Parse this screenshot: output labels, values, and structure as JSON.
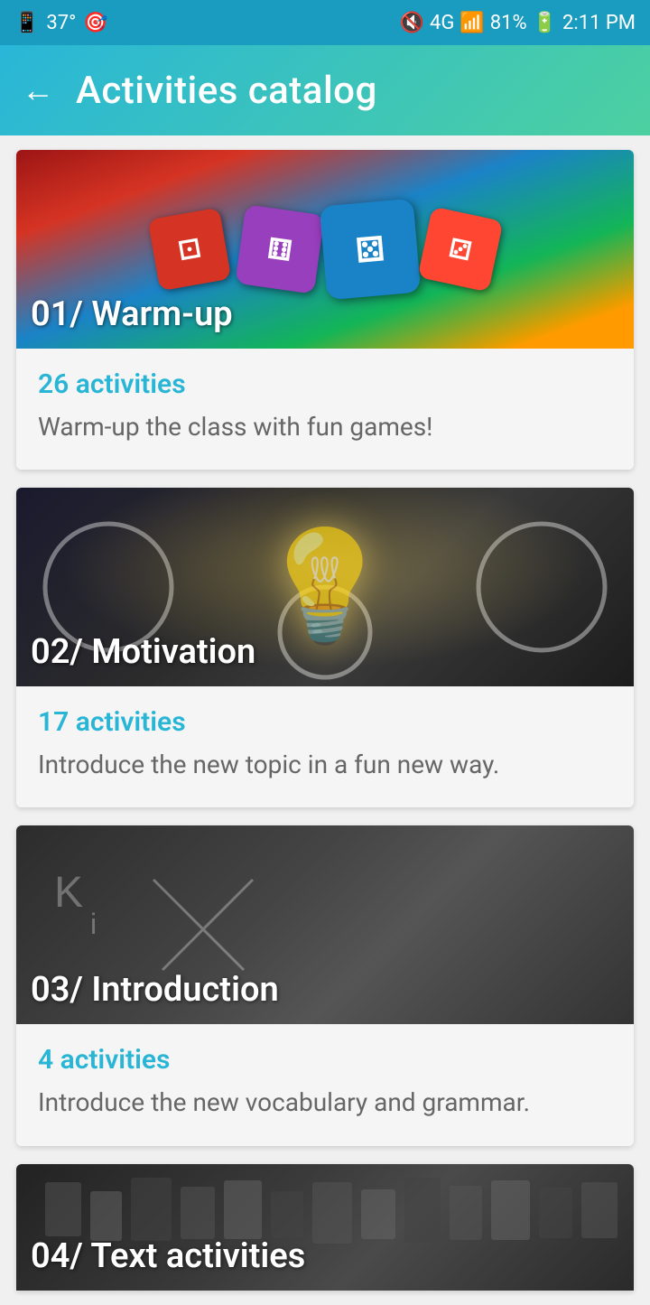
{
  "statusBar": {
    "battery": "37°",
    "signal": "4G",
    "batteryPercent": "81%",
    "time": "2:11 PM"
  },
  "toolbar": {
    "backLabel": "←",
    "title": "Activities catalog"
  },
  "cards": [
    {
      "id": "01",
      "title": "01/ Warm-up",
      "activitiesCount": "26 activities",
      "description": "Warm-up the class with fun games!",
      "theme": "warmup"
    },
    {
      "id": "02",
      "title": "02/ Motivation",
      "activitiesCount": "17 activities",
      "description": "Introduce the new topic in a fun new way.",
      "theme": "motivation"
    },
    {
      "id": "03",
      "title": "03/ Introduction",
      "activitiesCount": "4 activities",
      "description": "Introduce the new vocabulary and grammar.",
      "theme": "introduction"
    },
    {
      "id": "04",
      "title": "04/ Text activities",
      "activitiesCount": "",
      "description": "",
      "theme": "type"
    }
  ]
}
